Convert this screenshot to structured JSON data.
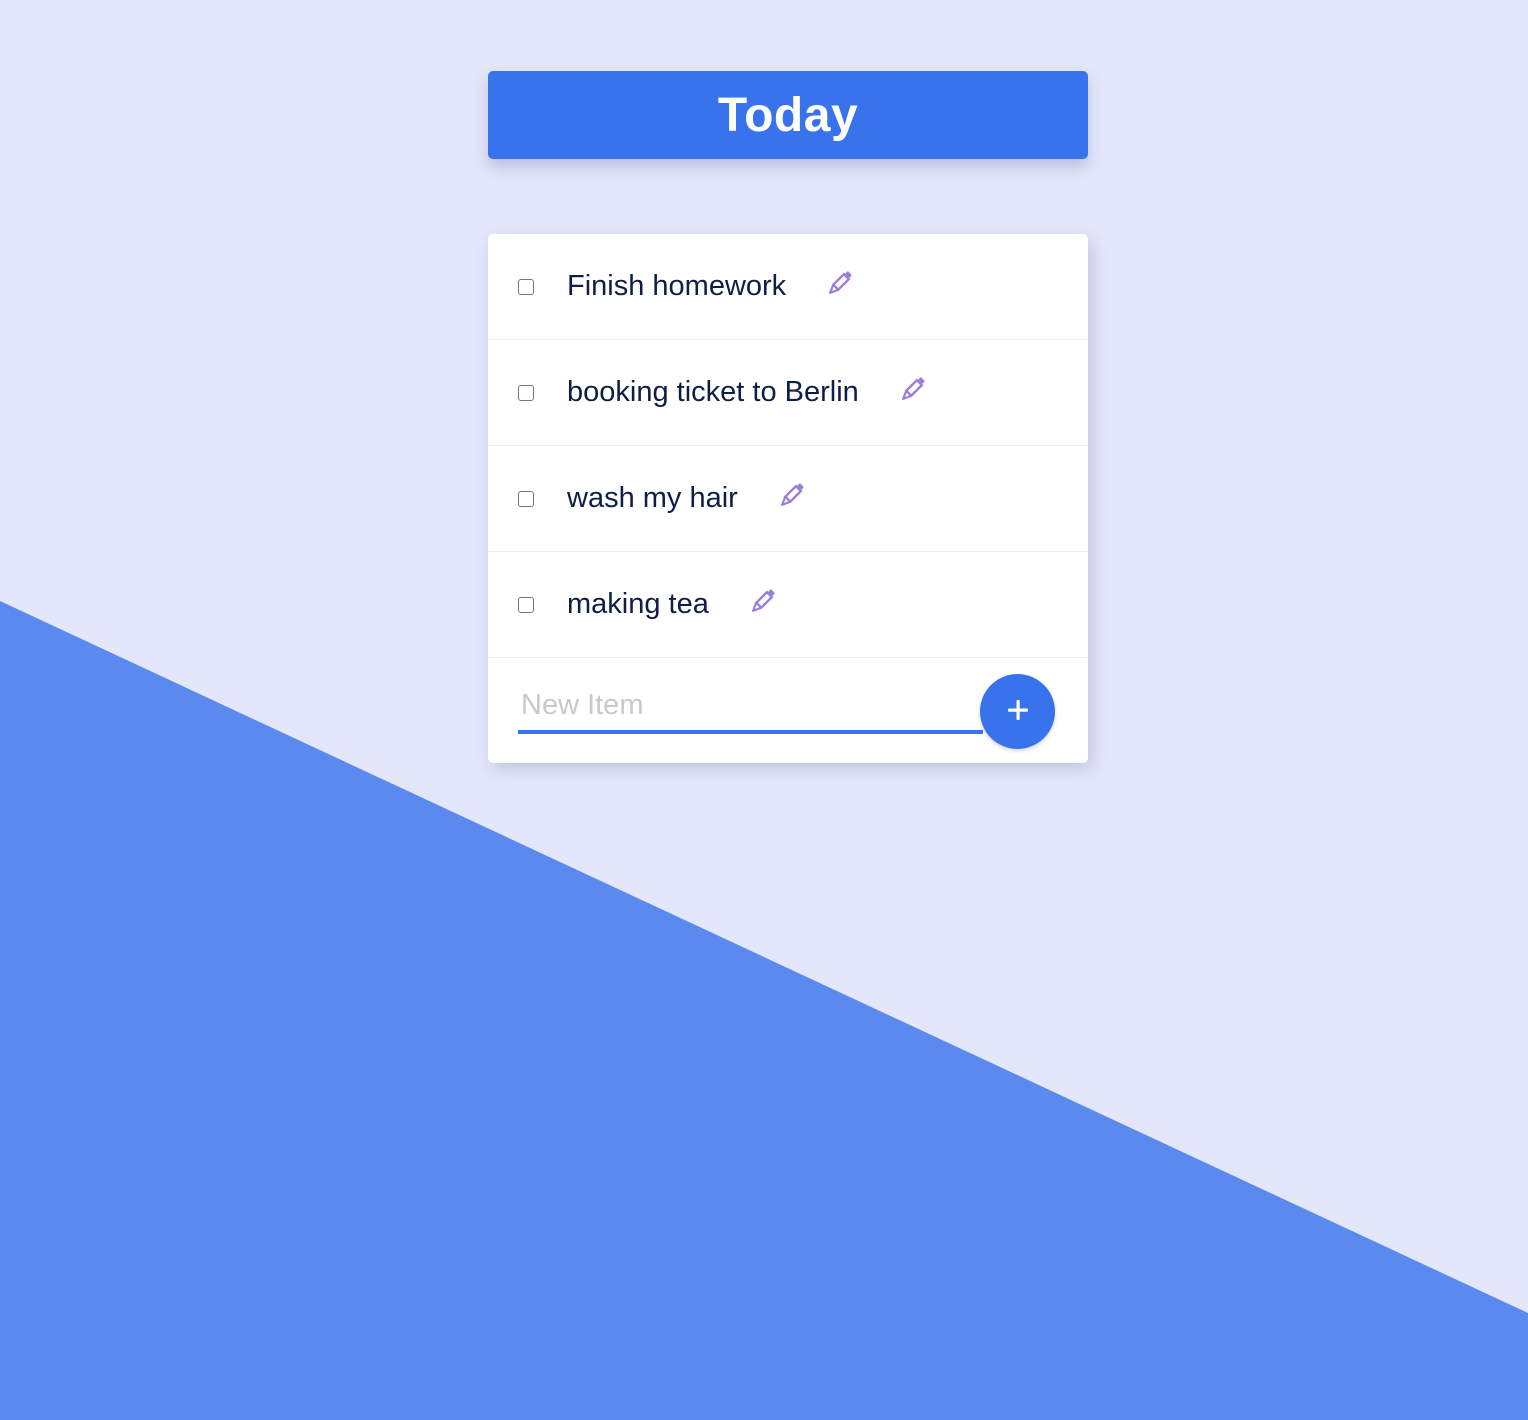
{
  "header": {
    "title": "Today"
  },
  "todo_list": {
    "items": [
      {
        "label": "Finish homework",
        "checked": false
      },
      {
        "label": "booking ticket to Berlin",
        "checked": false
      },
      {
        "label": "wash my hair",
        "checked": false
      },
      {
        "label": "making tea",
        "checked": false
      }
    ],
    "new_item": {
      "value": "",
      "placeholder": "New Item"
    },
    "add_button_label": "+"
  },
  "colors": {
    "page_background": "#e4e7fa",
    "accent": "#3873eb",
    "background_wedge": "#5a8aee",
    "edit_icon": "#9b7fd9",
    "item_text": "#0e1e45",
    "placeholder": "#c9c9cc"
  },
  "icons": {
    "edit": "pencil-icon",
    "add": "plus-icon"
  }
}
